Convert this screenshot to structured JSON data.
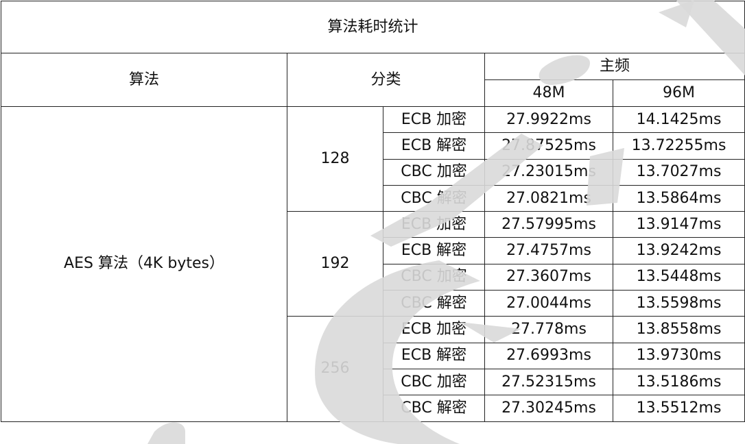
{
  "table": {
    "title": "算法耗时统计",
    "header": {
      "algorithm": "算法",
      "category": "分类",
      "frequency": "主频",
      "freq_48": "48M",
      "freq_96": "96M"
    },
    "algorithm_name": "AES 算法（4K bytes）",
    "groups": [
      {
        "key": "128",
        "rows": [
          {
            "op": "ECB 加密",
            "t48": "27.9922ms",
            "t96": "14.1425ms"
          },
          {
            "op": "ECB 解密",
            "t48": "27.87525ms",
            "t96": "13.72255ms"
          },
          {
            "op": "CBC 加密",
            "t48": "27.23015ms",
            "t96": "13.7027ms"
          },
          {
            "op": "CBC 解密",
            "t48": "27.0821ms",
            "t96": "13.5864ms"
          }
        ]
      },
      {
        "key": "192",
        "rows": [
          {
            "op": "ECB 加密",
            "t48": "27.57995ms",
            "t96": "13.9147ms"
          },
          {
            "op": "ECB 解密",
            "t48": "27.4757ms",
            "t96": "13.9242ms"
          },
          {
            "op": "CBC 加密",
            "t48": "27.3607ms",
            "t96": "13.5448ms"
          },
          {
            "op": "CBC 解密",
            "t48": "27.0044ms",
            "t96": "13.5598ms"
          }
        ]
      },
      {
        "key": "256",
        "rows": [
          {
            "op": "ECB 加密",
            "t48": "27.778ms",
            "t96": "13.8558ms"
          },
          {
            "op": "ECB 解密",
            "t48": "27.6993ms",
            "t96": "13.9730ms"
          },
          {
            "op": "CBC 加密",
            "t48": "27.52315ms",
            "t96": "13.5186ms"
          },
          {
            "op": "CBC 解密",
            "t48": "27.30245ms",
            "t96": "13.5512ms"
          }
        ]
      }
    ]
  },
  "watermark": {
    "color": "#d9d9d9"
  }
}
